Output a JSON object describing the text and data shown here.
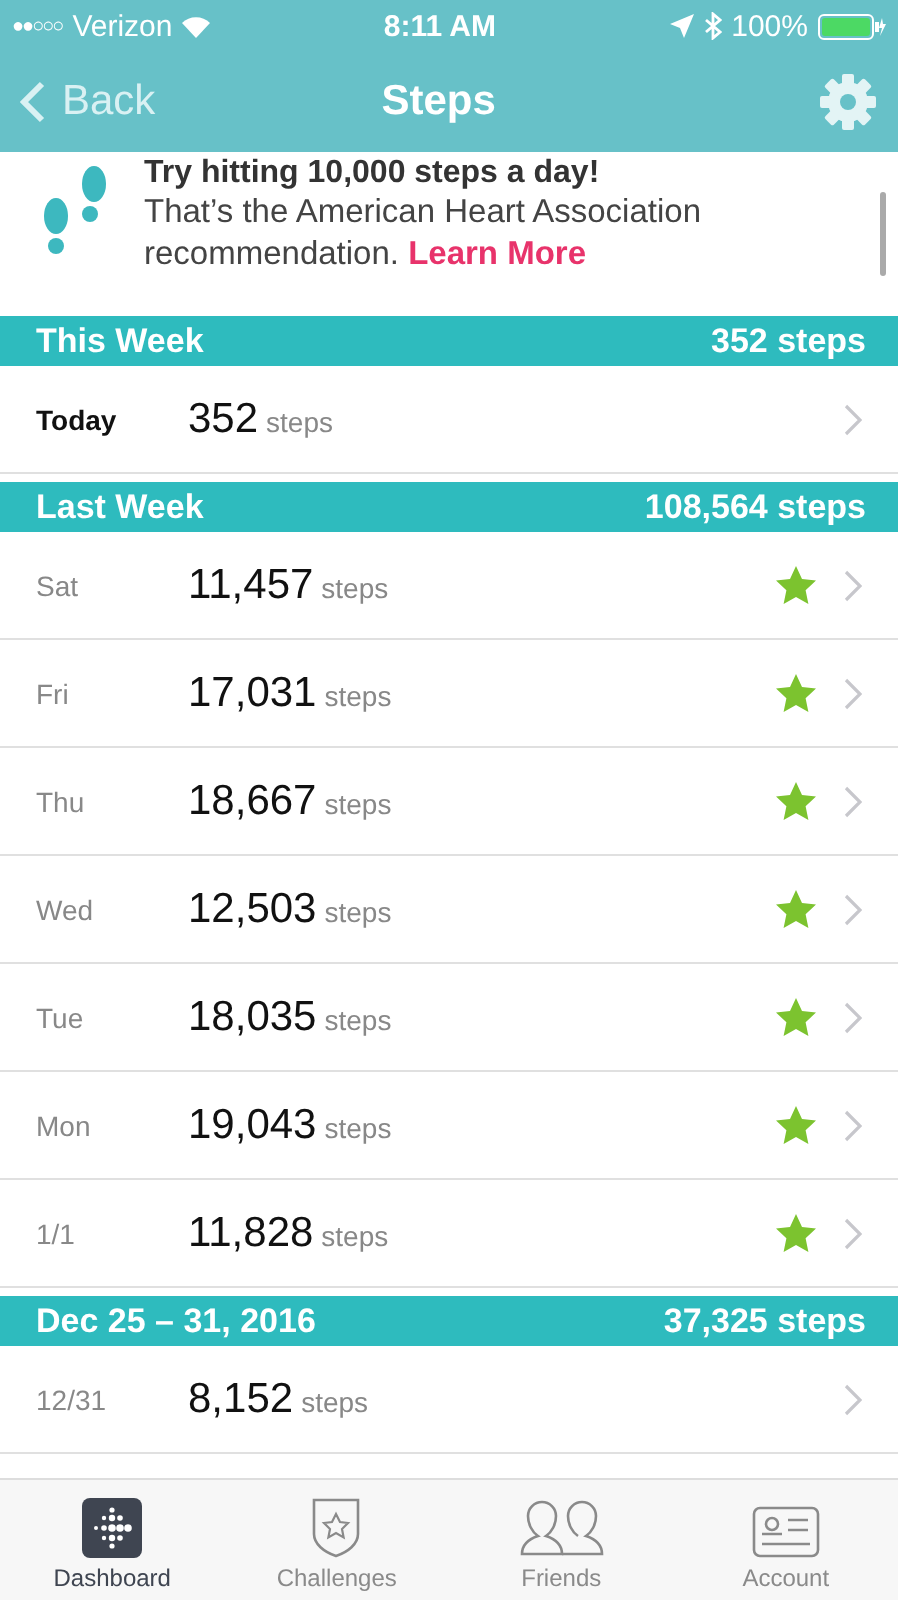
{
  "status_bar": {
    "signal": "●●○○○",
    "carrier": "Verizon",
    "time": "8:11 AM",
    "battery": "100%"
  },
  "nav": {
    "back": "Back",
    "title": "Steps"
  },
  "tip": {
    "headline": "Try hitting 10,000 steps a day!",
    "text": "That’s the American Heart Association recommendation.",
    "link": "Learn More"
  },
  "sections": [
    {
      "title": "This Week",
      "total": "352 steps",
      "days": [
        {
          "day": "Today",
          "current": true,
          "count": "352",
          "unit": "steps",
          "star": false
        }
      ]
    },
    {
      "title": "Last Week",
      "total": "108,564 steps",
      "days": [
        {
          "day": "Sat",
          "current": false,
          "count": "11,457",
          "unit": "steps",
          "star": true
        },
        {
          "day": "Fri",
          "current": false,
          "count": "17,031",
          "unit": "steps",
          "star": true
        },
        {
          "day": "Thu",
          "current": false,
          "count": "18,667",
          "unit": "steps",
          "star": true
        },
        {
          "day": "Wed",
          "current": false,
          "count": "12,503",
          "unit": "steps",
          "star": true
        },
        {
          "day": "Tue",
          "current": false,
          "count": "18,035",
          "unit": "steps",
          "star": true
        },
        {
          "day": "Mon",
          "current": false,
          "count": "19,043",
          "unit": "steps",
          "star": true
        },
        {
          "day": "1/1",
          "current": false,
          "count": "11,828",
          "unit": "steps",
          "star": true
        }
      ]
    },
    {
      "title": "Dec 25 – 31, 2016",
      "total": "37,325 steps",
      "days": [
        {
          "day": "12/31",
          "current": false,
          "count": "8,152",
          "unit": "steps",
          "star": false
        }
      ]
    }
  ],
  "tabs": [
    {
      "label": "Dashboard",
      "selected": true
    },
    {
      "label": "Challenges",
      "selected": false
    },
    {
      "label": "Friends",
      "selected": false
    },
    {
      "label": "Account",
      "selected": false
    }
  ]
}
